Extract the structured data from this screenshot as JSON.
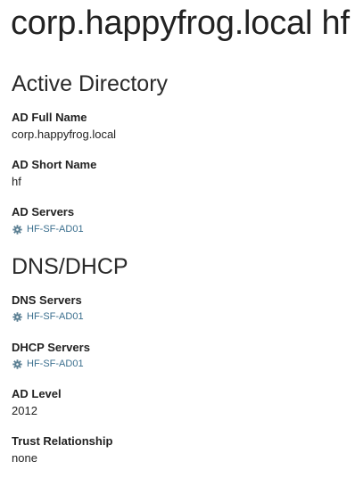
{
  "page": {
    "title": "corp.happyfrog.local hf"
  },
  "active_directory": {
    "heading": "Active Directory",
    "full_name": {
      "label": "AD Full Name",
      "value": "corp.happyfrog.local"
    },
    "short_name": {
      "label": "AD Short Name",
      "value": "hf"
    },
    "servers": {
      "label": "AD Servers",
      "items": [
        "HF-SF-AD01"
      ]
    }
  },
  "dns_dhcp": {
    "heading": "DNS/DHCP",
    "dns_servers": {
      "label": "DNS Servers",
      "items": [
        "HF-SF-AD01"
      ]
    },
    "dhcp_servers": {
      "label": "DHCP Servers",
      "items": [
        "HF-SF-AD01"
      ]
    },
    "ad_level": {
      "label": "AD Level",
      "value": "2012"
    },
    "trust_relationship": {
      "label": "Trust Relationship",
      "value": "none"
    }
  },
  "icons": {
    "server_link_icon": "gear-icon"
  },
  "colors": {
    "link": "#3b6f8e",
    "icon": "#5b7f93",
    "text": "#222222"
  }
}
